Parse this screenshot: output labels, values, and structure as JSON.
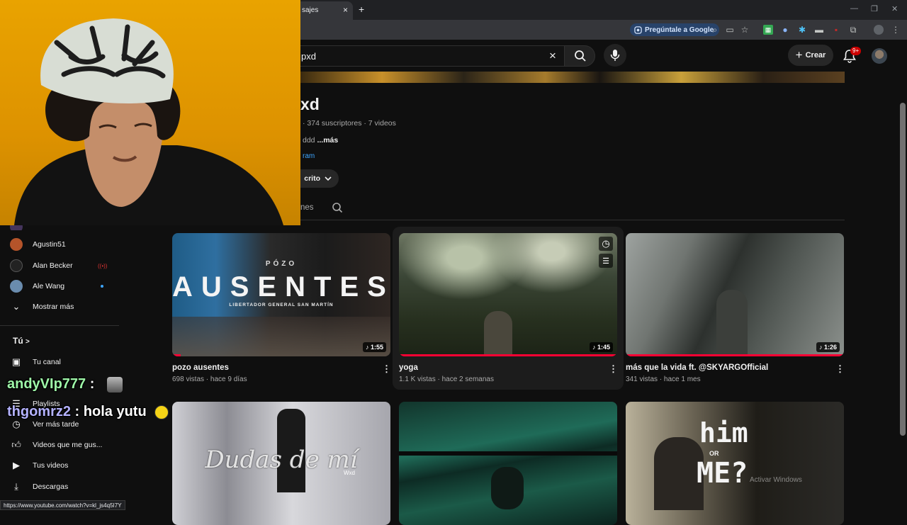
{
  "browser": {
    "tab_title": "sajes",
    "tab_close": "×",
    "new_tab": "+",
    "ask_google": "Pregúntale a Google",
    "status_url": "https://www.youtube.com/watch?v=kl_js4q5I7Y"
  },
  "header": {
    "search_value": "pxd",
    "search_clear": "×",
    "create_label": "Crear",
    "notification_badge": "9+"
  },
  "channel": {
    "name": "xd",
    "meta": "· 374 suscriptores · 7 videos",
    "desc_text": "ddd ",
    "desc_more": "...más",
    "link_text": "ram",
    "subscribed_label": "crito",
    "tab_partial": "nes"
  },
  "sidebar": {
    "subscriptions": [
      {
        "label": "Agustin51",
        "avatar_color": "#b5542a"
      },
      {
        "label": "Alan Becker",
        "avatar_color": "#222222"
      },
      {
        "label": "Ale Wang",
        "avatar_color": "#6a8cae"
      }
    ],
    "live_badge": "((•))",
    "show_more": "Mostrar más",
    "you_section": "Tú",
    "you_chevron": ">",
    "you_items": [
      {
        "label": "Tu canal",
        "icon": "user-square-icon"
      },
      {
        "label": "Playlists",
        "icon": "playlist-icon"
      },
      {
        "label": "Ver más tarde",
        "icon": "clock-icon"
      },
      {
        "label": "Videos que me gus...",
        "icon": "thumb-up-icon"
      },
      {
        "label": "Tus videos",
        "icon": "play-square-icon"
      },
      {
        "label": "Descargas",
        "icon": "download-icon"
      }
    ]
  },
  "chat": [
    {
      "user": "andyVIp777",
      "sep": " :",
      "message": ""
    },
    {
      "user": "thgomrz2",
      "sep": " :",
      "message": " hola yutu"
    }
  ],
  "videos": [
    {
      "title": "pozo ausentes",
      "meta": "698 vistas · hace 9 días",
      "duration": "♪ 1:55",
      "overlay_small": "PÓZO",
      "overlay_big": "AUSENTES",
      "overlay_sub": "LIBERTADOR GENERAL SAN MARTÍN",
      "watched": 0.04
    },
    {
      "title": "yoga",
      "meta": "1.1 K vistas · hace 2 semanas",
      "duration": "♪ 1:45",
      "watched": 1.0
    },
    {
      "title": "más que la vida ft. @SKYARGOfficial",
      "meta": "341 vistas · hace 1 mes",
      "duration": "♪ 1:26",
      "watched": 1.0
    },
    {
      "overlay_big": "Dudas de mí",
      "overlay_sub": "Wxd"
    },
    {},
    {
      "overlay_big": "him",
      "overlay_small": "OR",
      "overlay_sub": "ME?"
    }
  ],
  "watermark": "Activar Windows",
  "colors": {
    "accent_red": "#ff0033",
    "link_blue": "#3ea6ff",
    "background": "#0f0f0f"
  }
}
